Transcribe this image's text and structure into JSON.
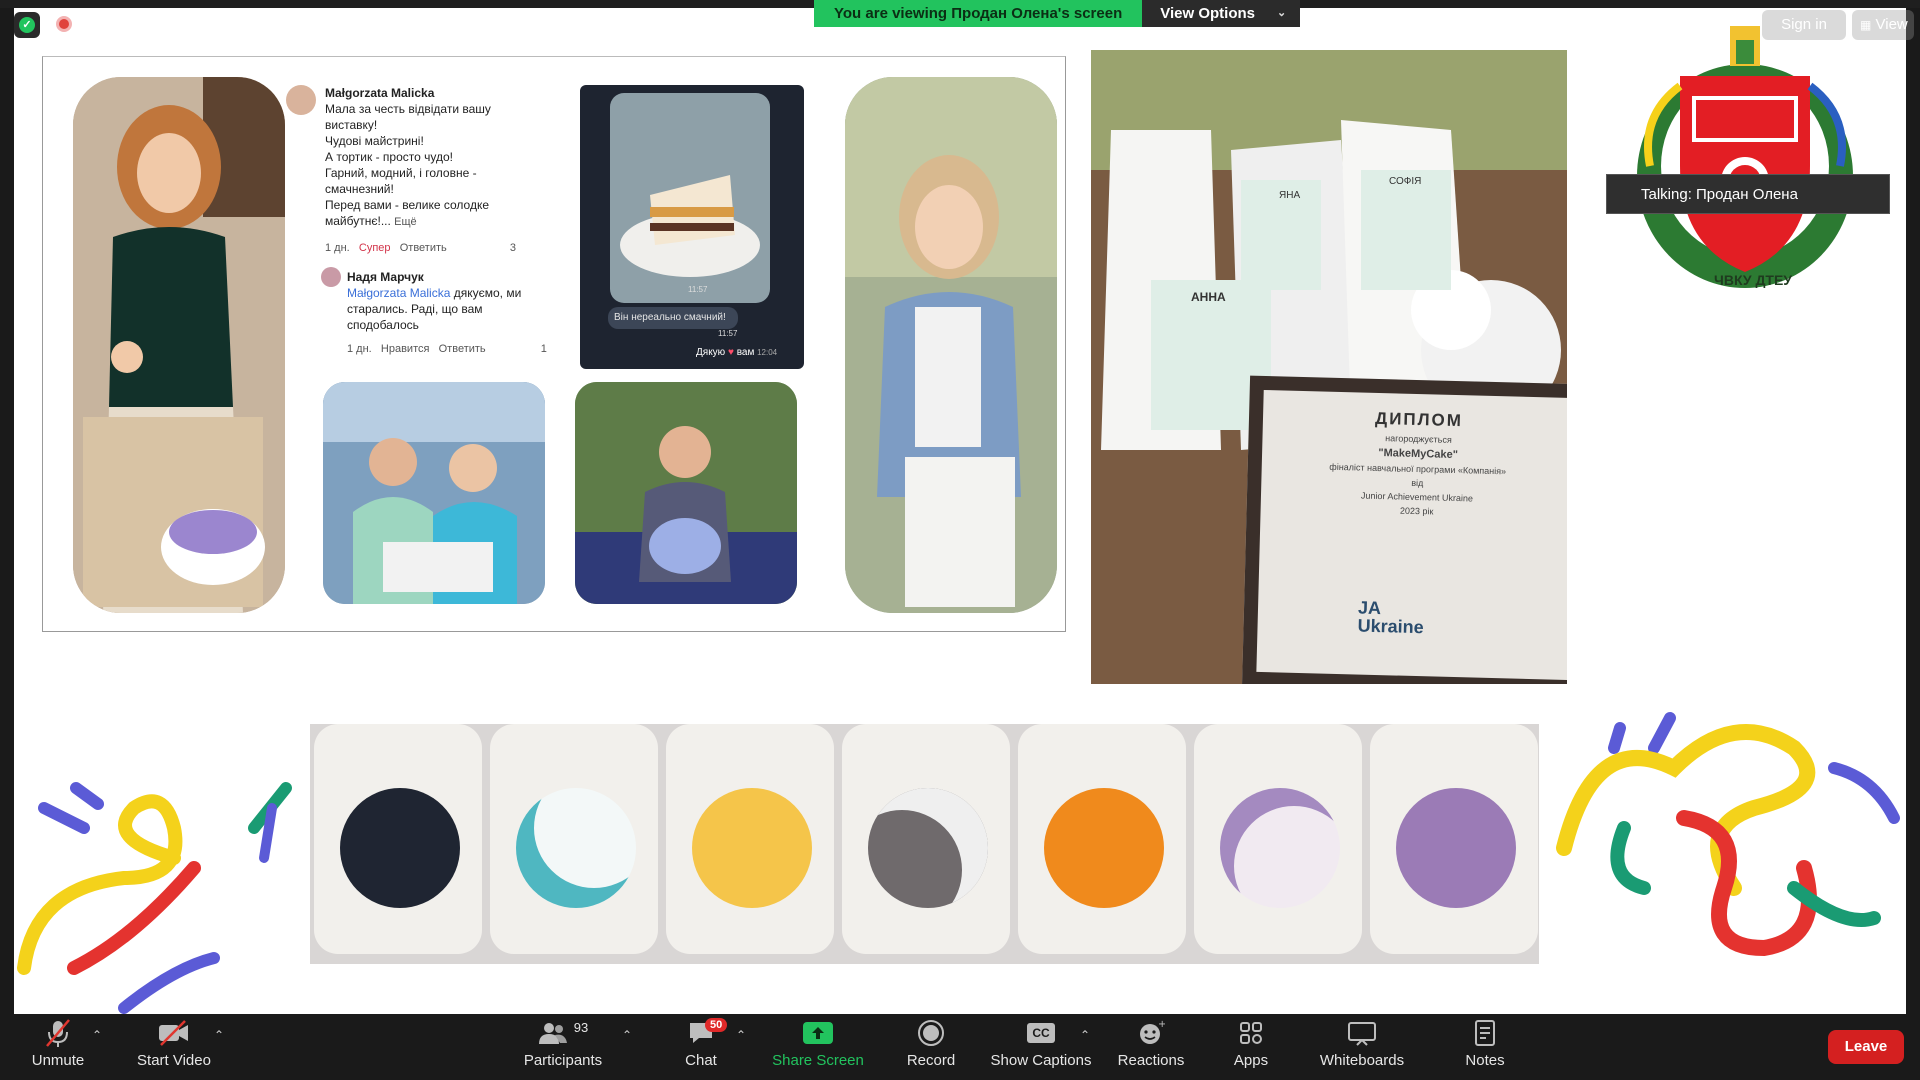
{
  "meeting": {
    "viewing_banner": "You are viewing Продан Олена's screen",
    "view_options": "View Options",
    "sign_in": "Sign in",
    "view": "View",
    "talking_tooltip": "Talking: Продан Олена"
  },
  "slide": {
    "comments": {
      "c1_author": "Małgorzata Malicka",
      "c1_text": [
        "Мала за честь відвідати вашу",
        "виставку!",
        "Чудові майстрині!",
        "А тортик - просто чудо!",
        "Гарний, модний, і головне -",
        "смачнезний!",
        "Перед вами - велике солодке",
        "майбутнє!..."
      ],
      "c1_more": "Ещё",
      "c1_meta_time": "1 дн.",
      "c1_meta_reaction": "Супер",
      "c1_meta_reply": "Ответить",
      "c1_meta_count": "3",
      "c2_author": "Надя Марчук",
      "c2_mention": "Małgorzata Malicka",
      "c2_text": [
        "дякуємо, ми",
        "старались. Раді, що вам",
        "сподобалось"
      ],
      "c2_meta_time": "1 дн.",
      "c2_meta_reaction": "Нравится",
      "c2_meta_reply": "Ответить",
      "c2_meta_count": "1"
    },
    "chat_photo": {
      "message": "Він нереально смачний!",
      "time1": "11:57",
      "time2": "11:57",
      "reply": "Дякую",
      "reply2": "вам",
      "time3": "12:04"
    },
    "bags": {
      "tag1": "ЯНА",
      "tag2": "СОФІЯ",
      "tag3": "АННА"
    },
    "diploma": {
      "title": "ДИПЛОМ",
      "line1": "нагороджується",
      "line2": "\"MakeMyCake\"",
      "line3": "фіналіст навчальної програми «Компанія»",
      "line4": "від",
      "line5": "Junior Achievement Ukraine",
      "line6": "2023 рік",
      "ja1": "JA",
      "ja2": "Ukraine"
    },
    "emblem_text": "ЧВКУ ДТЕУ"
  },
  "toolbar": {
    "unmute": "Unmute",
    "start_video": "Start Video",
    "participants": "Participants",
    "participants_count": "93",
    "chat": "Chat",
    "chat_badge": "50",
    "share_screen": "Share Screen",
    "record": "Record",
    "show_captions": "Show Captions",
    "cc": "CC",
    "reactions": "Reactions",
    "apps": "Apps",
    "whiteboards": "Whiteboards",
    "notes": "Notes",
    "leave": "Leave"
  },
  "colors": {
    "share_green": "#22c35e",
    "leave_red": "#d42020",
    "toolbar_bg": "#1a1a1a"
  }
}
